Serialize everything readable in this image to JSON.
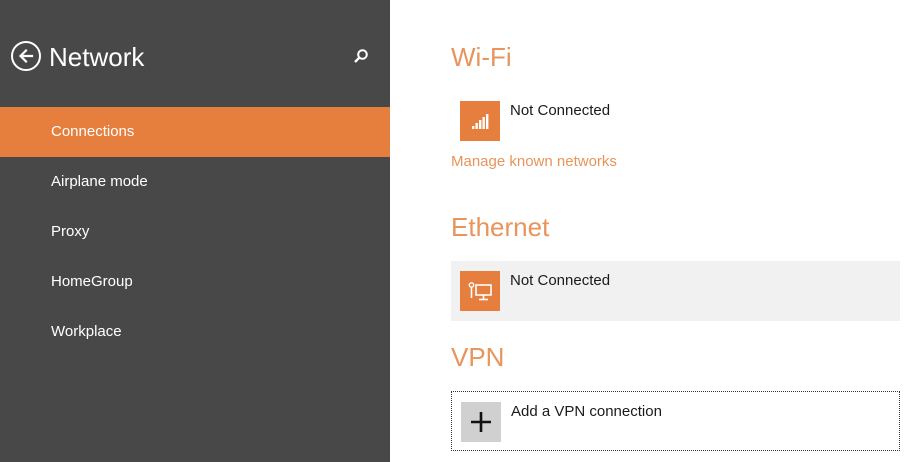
{
  "sidebar": {
    "title": "Network",
    "back_icon": "back-arrow-icon",
    "search_icon": "search-icon",
    "items": [
      {
        "label": "Connections",
        "active": true
      },
      {
        "label": "Airplane mode",
        "active": false
      },
      {
        "label": "Proxy",
        "active": false
      },
      {
        "label": "HomeGroup",
        "active": false
      },
      {
        "label": "Workplace",
        "active": false
      }
    ]
  },
  "wifi": {
    "title": "Wi-Fi",
    "status": "Not Connected",
    "icon": "wifi-signal-icon",
    "manage_link": "Manage known networks"
  },
  "ethernet": {
    "title": "Ethernet",
    "status": "Not Connected",
    "icon": "ethernet-icon"
  },
  "vpn": {
    "title": "VPN",
    "add_label": "Add a VPN connection",
    "icon": "plus-icon"
  },
  "colors": {
    "accent": "#e67e3e",
    "accent_text": "#e8945b",
    "sidebar_bg": "#484848"
  }
}
